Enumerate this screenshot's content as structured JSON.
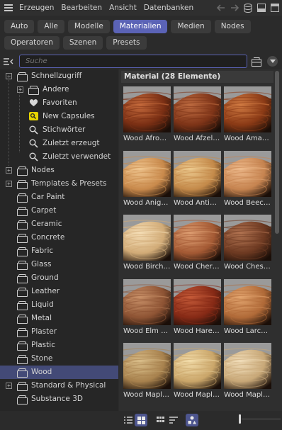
{
  "menubar": {
    "items": [
      "Erzeugen",
      "Bearbeiten",
      "Ansicht",
      "Datenbanken"
    ],
    "icons": [
      "arrow-left-icon",
      "arrow-right-icon",
      "database-icon",
      "panel-icon",
      "window-icon"
    ]
  },
  "filters": {
    "row1": [
      "Auto",
      "Alle",
      "Modelle",
      "Materialien",
      "Medien",
      "Nodes"
    ],
    "row2": [
      "Operatoren",
      "Szenen",
      "Presets"
    ],
    "active": "Materialien"
  },
  "search": {
    "placeholder": "Suche"
  },
  "tree": [
    {
      "label": "Schnellzugriff",
      "icon": "library",
      "indent": 0,
      "expander": "-"
    },
    {
      "label": "Andere",
      "icon": "library",
      "indent": 1,
      "expander": "+"
    },
    {
      "label": "Favoriten",
      "icon": "heart",
      "indent": 1
    },
    {
      "label": "New Capsules",
      "icon": "capsule",
      "indent": 1
    },
    {
      "label": "Stichwörter",
      "icon": "search",
      "indent": 1
    },
    {
      "label": "Zuletzt erzeugt",
      "icon": "search",
      "indent": 1
    },
    {
      "label": "Zuletzt verwendet",
      "icon": "search",
      "indent": 1
    },
    {
      "label": "Nodes",
      "icon": "library",
      "indent": 0,
      "expander": "+"
    },
    {
      "label": "Templates & Presets",
      "icon": "library",
      "indent": 0,
      "expander": "+"
    },
    {
      "label": "Car Paint",
      "icon": "library",
      "indent": 0
    },
    {
      "label": "Carpet",
      "icon": "library",
      "indent": 0
    },
    {
      "label": "Ceramic",
      "icon": "library",
      "indent": 0
    },
    {
      "label": "Concrete",
      "icon": "library",
      "indent": 0
    },
    {
      "label": "Fabric",
      "icon": "library",
      "indent": 0
    },
    {
      "label": "Glass",
      "icon": "library",
      "indent": 0
    },
    {
      "label": "Ground",
      "icon": "library",
      "indent": 0
    },
    {
      "label": "Leather",
      "icon": "library",
      "indent": 0
    },
    {
      "label": "Liquid",
      "icon": "library",
      "indent": 0
    },
    {
      "label": "Metal",
      "icon": "library",
      "indent": 0
    },
    {
      "label": "Plaster",
      "icon": "library",
      "indent": 0
    },
    {
      "label": "Plastic",
      "icon": "library",
      "indent": 0
    },
    {
      "label": "Stone",
      "icon": "library",
      "indent": 0
    },
    {
      "label": "Wood",
      "icon": "library",
      "indent": 0,
      "selected": true
    },
    {
      "label": "Standard & Physical",
      "icon": "library",
      "indent": 0,
      "expander": "+"
    },
    {
      "label": "Substance 3D",
      "icon": "library",
      "indent": 0
    }
  ],
  "materials": {
    "header": "Material (28 Elemente)",
    "items": [
      {
        "name": "Wood Afro…",
        "base": "#7a2f14",
        "light": "#c56a3c"
      },
      {
        "name": "Wood Afzel…",
        "base": "#7e3418",
        "light": "#bd6a40"
      },
      {
        "name": "Wood Ama…",
        "base": "#8a3a16",
        "light": "#d07a42"
      },
      {
        "name": "Wood Anig…",
        "base": "#c98a4c",
        "light": "#f0c690"
      },
      {
        "name": "Wood Anti…",
        "base": "#c48a4a",
        "light": "#ecc98e"
      },
      {
        "name": "Wood Beec…",
        "base": "#c68450",
        "light": "#eeba8c"
      },
      {
        "name": "Wood Birch…",
        "base": "#d2ac78",
        "light": "#f4dcb4"
      },
      {
        "name": "Wood Cher…",
        "base": "#a45a34",
        "light": "#dc9c70"
      },
      {
        "name": "Wood Ches…",
        "base": "#6e3a22",
        "light": "#b07250"
      },
      {
        "name": "Wood Elm …",
        "base": "#8e5434",
        "light": "#c89068"
      },
      {
        "name": "Wood Hare…",
        "base": "#862a16",
        "light": "#c45a38"
      },
      {
        "name": "Wood Larc…",
        "base": "#b06a38",
        "light": "#e2a46e"
      },
      {
        "name": "Wood Mapl…",
        "base": "#a8824e",
        "light": "#d8bc88"
      },
      {
        "name": "Wood Mapl…",
        "base": "#caa66a",
        "light": "#f2dcaa"
      },
      {
        "name": "Wood Mapl…",
        "base": "#c8a878",
        "light": "#f0dcb8"
      }
    ]
  },
  "bottombar": {
    "icons": [
      "list-view-icon",
      "grid-view-icon",
      "sort-grid-icon",
      "sort-list-icon",
      "filter-types-icon",
      "zoom-slider"
    ]
  }
}
